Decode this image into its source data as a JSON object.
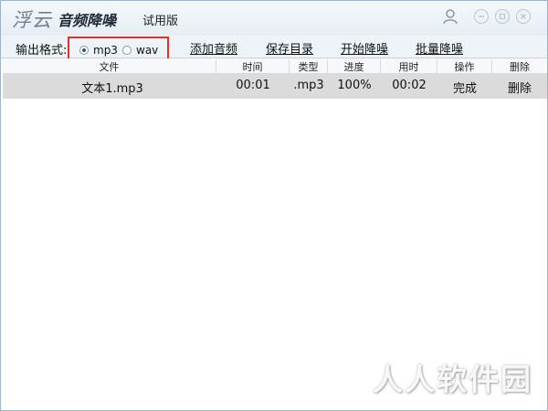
{
  "app": {
    "logo_text": "浮云",
    "name": "音频降噪",
    "edition": "试用版"
  },
  "toolbar": {
    "format_label": "输出格式:",
    "formats": [
      {
        "label": "mp3",
        "selected": true
      },
      {
        "label": "wav",
        "selected": false
      }
    ],
    "add_audio": "添加音频",
    "save_dir": "保存目录",
    "start_denoise": "开始降噪",
    "batch_denoise": "批量降噪"
  },
  "table": {
    "columns": [
      "文件",
      "时间",
      "类型",
      "进度",
      "用时",
      "操作",
      "删除"
    ],
    "rows": [
      {
        "file": "文本1.mp3",
        "time": "00:01",
        "type": ".mp3",
        "progress": "100%",
        "elapsed": "00:02",
        "action": "完成",
        "delete": "删除"
      }
    ]
  },
  "watermark": "人人软件园",
  "colors": {
    "accent_highlight": "#e0302a",
    "row_selected": "#dcdbdc"
  }
}
